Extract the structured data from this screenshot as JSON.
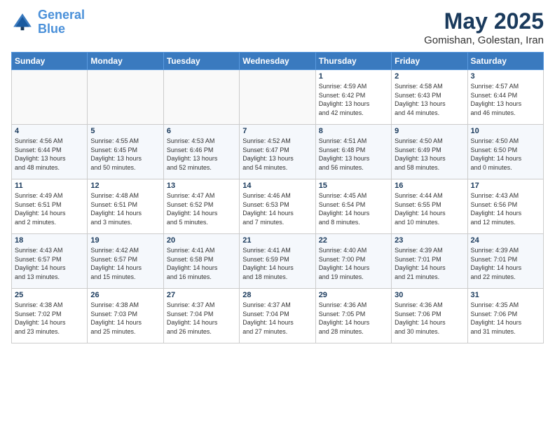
{
  "logo": {
    "line1": "General",
    "line2": "Blue"
  },
  "title": "May 2025",
  "subtitle": "Gomishan, Golestan, Iran",
  "weekdays": [
    "Sunday",
    "Monday",
    "Tuesday",
    "Wednesday",
    "Thursday",
    "Friday",
    "Saturday"
  ],
  "weeks": [
    [
      {
        "day": "",
        "info": ""
      },
      {
        "day": "",
        "info": ""
      },
      {
        "day": "",
        "info": ""
      },
      {
        "day": "",
        "info": ""
      },
      {
        "day": "1",
        "info": "Sunrise: 4:59 AM\nSunset: 6:42 PM\nDaylight: 13 hours\nand 42 minutes."
      },
      {
        "day": "2",
        "info": "Sunrise: 4:58 AM\nSunset: 6:43 PM\nDaylight: 13 hours\nand 44 minutes."
      },
      {
        "day": "3",
        "info": "Sunrise: 4:57 AM\nSunset: 6:44 PM\nDaylight: 13 hours\nand 46 minutes."
      }
    ],
    [
      {
        "day": "4",
        "info": "Sunrise: 4:56 AM\nSunset: 6:44 PM\nDaylight: 13 hours\nand 48 minutes."
      },
      {
        "day": "5",
        "info": "Sunrise: 4:55 AM\nSunset: 6:45 PM\nDaylight: 13 hours\nand 50 minutes."
      },
      {
        "day": "6",
        "info": "Sunrise: 4:53 AM\nSunset: 6:46 PM\nDaylight: 13 hours\nand 52 minutes."
      },
      {
        "day": "7",
        "info": "Sunrise: 4:52 AM\nSunset: 6:47 PM\nDaylight: 13 hours\nand 54 minutes."
      },
      {
        "day": "8",
        "info": "Sunrise: 4:51 AM\nSunset: 6:48 PM\nDaylight: 13 hours\nand 56 minutes."
      },
      {
        "day": "9",
        "info": "Sunrise: 4:50 AM\nSunset: 6:49 PM\nDaylight: 13 hours\nand 58 minutes."
      },
      {
        "day": "10",
        "info": "Sunrise: 4:50 AM\nSunset: 6:50 PM\nDaylight: 14 hours\nand 0 minutes."
      }
    ],
    [
      {
        "day": "11",
        "info": "Sunrise: 4:49 AM\nSunset: 6:51 PM\nDaylight: 14 hours\nand 2 minutes."
      },
      {
        "day": "12",
        "info": "Sunrise: 4:48 AM\nSunset: 6:51 PM\nDaylight: 14 hours\nand 3 minutes."
      },
      {
        "day": "13",
        "info": "Sunrise: 4:47 AM\nSunset: 6:52 PM\nDaylight: 14 hours\nand 5 minutes."
      },
      {
        "day": "14",
        "info": "Sunrise: 4:46 AM\nSunset: 6:53 PM\nDaylight: 14 hours\nand 7 minutes."
      },
      {
        "day": "15",
        "info": "Sunrise: 4:45 AM\nSunset: 6:54 PM\nDaylight: 14 hours\nand 8 minutes."
      },
      {
        "day": "16",
        "info": "Sunrise: 4:44 AM\nSunset: 6:55 PM\nDaylight: 14 hours\nand 10 minutes."
      },
      {
        "day": "17",
        "info": "Sunrise: 4:43 AM\nSunset: 6:56 PM\nDaylight: 14 hours\nand 12 minutes."
      }
    ],
    [
      {
        "day": "18",
        "info": "Sunrise: 4:43 AM\nSunset: 6:57 PM\nDaylight: 14 hours\nand 13 minutes."
      },
      {
        "day": "19",
        "info": "Sunrise: 4:42 AM\nSunset: 6:57 PM\nDaylight: 14 hours\nand 15 minutes."
      },
      {
        "day": "20",
        "info": "Sunrise: 4:41 AM\nSunset: 6:58 PM\nDaylight: 14 hours\nand 16 minutes."
      },
      {
        "day": "21",
        "info": "Sunrise: 4:41 AM\nSunset: 6:59 PM\nDaylight: 14 hours\nand 18 minutes."
      },
      {
        "day": "22",
        "info": "Sunrise: 4:40 AM\nSunset: 7:00 PM\nDaylight: 14 hours\nand 19 minutes."
      },
      {
        "day": "23",
        "info": "Sunrise: 4:39 AM\nSunset: 7:01 PM\nDaylight: 14 hours\nand 21 minutes."
      },
      {
        "day": "24",
        "info": "Sunrise: 4:39 AM\nSunset: 7:01 PM\nDaylight: 14 hours\nand 22 minutes."
      }
    ],
    [
      {
        "day": "25",
        "info": "Sunrise: 4:38 AM\nSunset: 7:02 PM\nDaylight: 14 hours\nand 23 minutes."
      },
      {
        "day": "26",
        "info": "Sunrise: 4:38 AM\nSunset: 7:03 PM\nDaylight: 14 hours\nand 25 minutes."
      },
      {
        "day": "27",
        "info": "Sunrise: 4:37 AM\nSunset: 7:04 PM\nDaylight: 14 hours\nand 26 minutes."
      },
      {
        "day": "28",
        "info": "Sunrise: 4:37 AM\nSunset: 7:04 PM\nDaylight: 14 hours\nand 27 minutes."
      },
      {
        "day": "29",
        "info": "Sunrise: 4:36 AM\nSunset: 7:05 PM\nDaylight: 14 hours\nand 28 minutes."
      },
      {
        "day": "30",
        "info": "Sunrise: 4:36 AM\nSunset: 7:06 PM\nDaylight: 14 hours\nand 30 minutes."
      },
      {
        "day": "31",
        "info": "Sunrise: 4:35 AM\nSunset: 7:06 PM\nDaylight: 14 hours\nand 31 minutes."
      }
    ]
  ]
}
